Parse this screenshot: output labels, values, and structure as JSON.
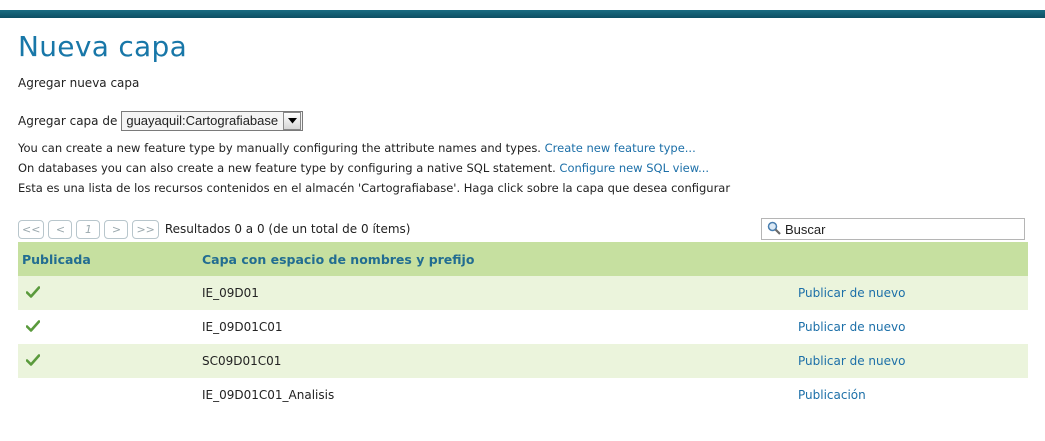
{
  "page": {
    "title": "Nueva capa",
    "subtitle": "Agregar nueva capa"
  },
  "add_layer": {
    "label": "Agregar capa de",
    "selected": "guayaquil:Cartografiabase"
  },
  "info": {
    "line1_text": "You can create a new feature type by manually configuring the attribute names and types.",
    "line1_link": "Create new feature type...",
    "line2_text": "On databases you can also create a new feature type by configuring a native SQL statement.",
    "line2_link": "Configure new SQL view...",
    "line3_text": "Esta es una lista de los recursos contenidos en el almacén 'Cartografiabase'. Haga click sobre la capa que desea configurar"
  },
  "pager": {
    "first": "<<",
    "prev": "<",
    "page": "1",
    "next": ">",
    "last": ">>",
    "results": "Resultados 0 a 0 (de un total de 0 ítems)"
  },
  "search": {
    "placeholder": "Buscar",
    "icon": "magnifier-icon"
  },
  "table": {
    "headers": [
      "Publicada",
      "Capa con espacio de nombres y prefijo",
      ""
    ],
    "rows": [
      {
        "published": true,
        "name": "IE_09D01",
        "action": "Publicar de nuevo"
      },
      {
        "published": true,
        "name": "IE_09D01C01",
        "action": "Publicar de nuevo"
      },
      {
        "published": true,
        "name": "SC09D01C01",
        "action": "Publicar de nuevo"
      },
      {
        "published": false,
        "name": "IE_09D01C01_Analisis",
        "action": "Publicación"
      }
    ]
  },
  "colors": {
    "title": "#1877a8",
    "header_bg": "#c6e0a0",
    "alt_row_bg": "#ebf4dc",
    "link": "#1c6fa8",
    "check": "#5a9a3c"
  }
}
